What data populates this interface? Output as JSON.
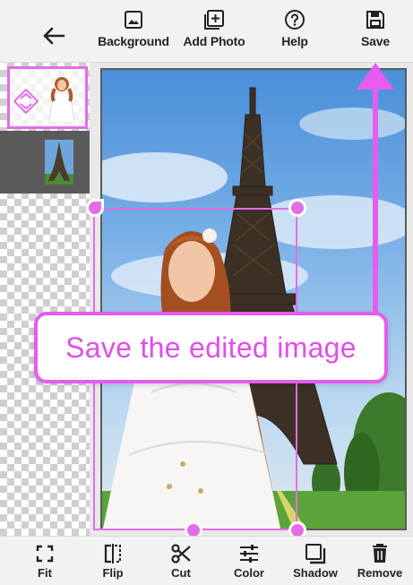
{
  "toolbar": {
    "back_icon": "arrow-left-icon",
    "items": [
      {
        "label": "Background",
        "icon": "image-icon"
      },
      {
        "label": "Add Photo",
        "icon": "add-photo-icon"
      },
      {
        "label": "Help",
        "icon": "help-circle-icon"
      },
      {
        "label": "Save",
        "icon": "save-icon"
      }
    ]
  },
  "callout": {
    "text": "Save the edited image",
    "accent_color": "#e65cf0"
  },
  "bottom_toolbar": {
    "items": [
      {
        "label": "Fit",
        "icon": "fit-icon"
      },
      {
        "label": "Flip",
        "icon": "flip-icon"
      },
      {
        "label": "Cut",
        "icon": "scissors-icon"
      },
      {
        "label": "Color",
        "icon": "sliders-icon"
      },
      {
        "label": "Shadow",
        "icon": "shadow-icon"
      },
      {
        "label": "Remove",
        "icon": "trash-icon"
      }
    ]
  },
  "colors": {
    "accent": "#e65cf0",
    "toolbar_bg": "#f2f2f2",
    "text": "#222222"
  }
}
